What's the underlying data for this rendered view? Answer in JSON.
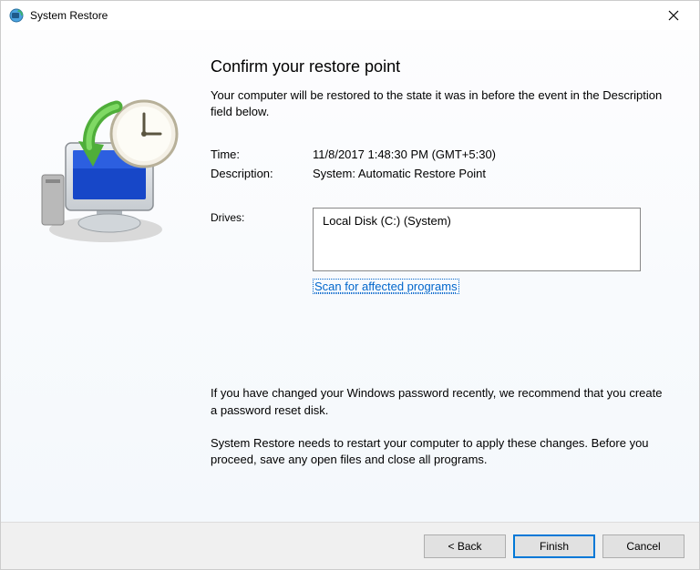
{
  "titlebar": {
    "title": "System Restore"
  },
  "main": {
    "heading": "Confirm your restore point",
    "subtext": "Your computer will be restored to the state it was in before the event in the Description field below.",
    "time_label": "Time:",
    "time_value": "11/8/2017 1:48:30 PM (GMT+5:30)",
    "description_label": "Description:",
    "description_value": "System: Automatic Restore Point",
    "drives_label": "Drives:",
    "drives_value": "Local Disk (C:) (System)",
    "scan_link": "Scan for affected programs",
    "password_note": "If you have changed your Windows password recently, we recommend that you create a password reset disk.",
    "restart_note": "System Restore needs to restart your computer to apply these changes. Before you proceed, save any open files and close all programs."
  },
  "buttons": {
    "back": "< Back",
    "finish": "Finish",
    "cancel": "Cancel"
  }
}
